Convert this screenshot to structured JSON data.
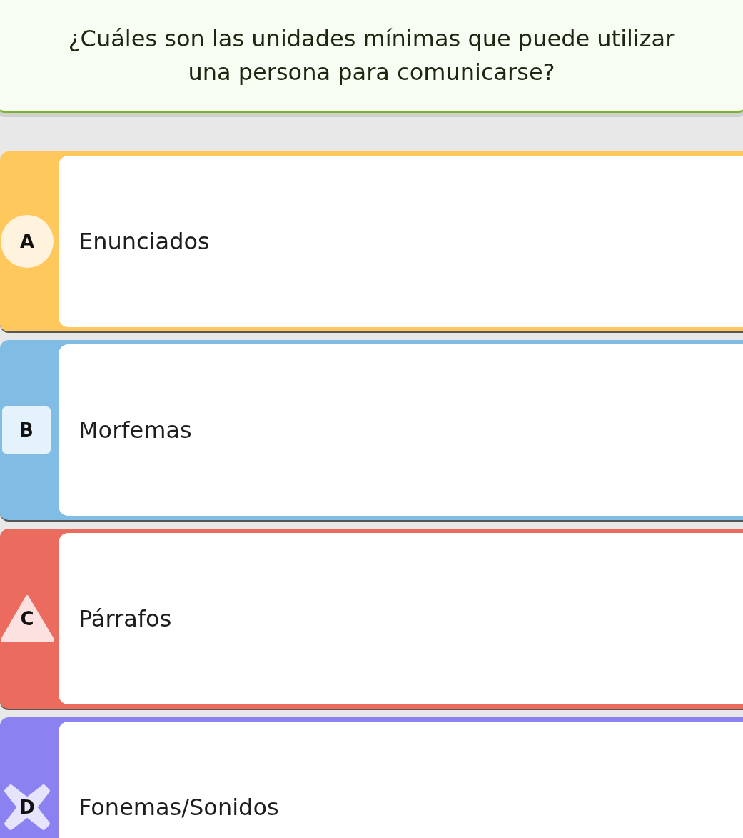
{
  "question": "¿Cuáles son las unidades mínimas que puede utilizar una persona para comunicarse?",
  "options": [
    {
      "letter": "A",
      "text": "Enunciados",
      "kind": "circle",
      "color": "#ffc85c"
    },
    {
      "letter": "B",
      "text": "Morfemas",
      "kind": "square",
      "color": "#80bce4"
    },
    {
      "letter": "C",
      "text": "Párrafos",
      "kind": "triangle",
      "color": "#ec6b5f"
    },
    {
      "letter": "D",
      "text": "Fonemas/Sonidos",
      "kind": "cross",
      "color": "#8c81f1"
    }
  ]
}
